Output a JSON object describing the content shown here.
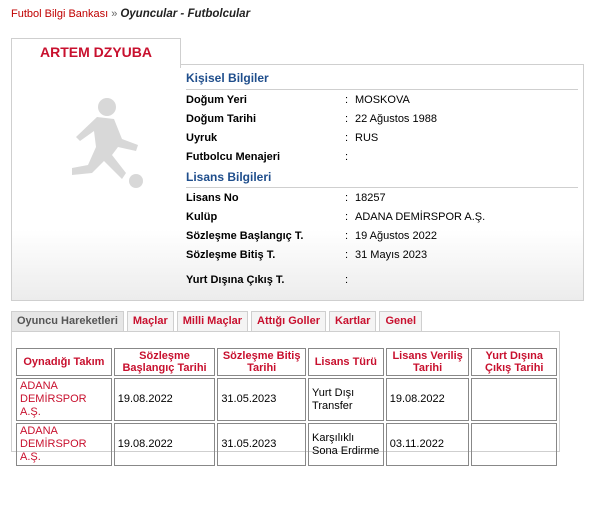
{
  "breadcrumb": {
    "root": "Futbol Bilgi Bankası",
    "separator": "»",
    "current": "Oyuncular - Futbolcular"
  },
  "player": {
    "name": "ARTEM DZYUBA"
  },
  "personal": {
    "title": "Kişisel Bilgiler",
    "rows": [
      {
        "label": "Doğum Yeri",
        "value": "MOSKOVA"
      },
      {
        "label": "Doğum Tarihi",
        "value": "22 Ağustos 1988"
      },
      {
        "label": "Uyruk",
        "value": "RUS"
      },
      {
        "label": "Futbolcu Menajeri",
        "value": ""
      }
    ]
  },
  "license": {
    "title": "Lisans Bilgileri",
    "rows": [
      {
        "label": "Lisans No",
        "value": "18257"
      },
      {
        "label": "Kulüp",
        "value": "ADANA DEMİRSPOR A.Ş."
      },
      {
        "label": "Sözleşme Başlangıç T.",
        "value": "19 Ağustos 2022"
      },
      {
        "label": "Sözleşme Bitiş T.",
        "value": "31 Mayıs 2023"
      },
      {
        "label": "Yurt Dışına Çıkış T.",
        "value": ""
      }
    ]
  },
  "tabs": [
    {
      "label": "Oyuncu Hareketleri",
      "active": true
    },
    {
      "label": "Maçlar"
    },
    {
      "label": "Milli Maçlar"
    },
    {
      "label": "Attığı Goller"
    },
    {
      "label": "Kartlar"
    },
    {
      "label": "Genel"
    }
  ],
  "movements": {
    "headers": [
      "Oynadığı Takım",
      "Sözleşme Başlangıç Tarihi",
      "Sözleşme Bitiş Tarihi",
      "Lisans Türü",
      "Lisans Veriliş Tarihi",
      "Yurt Dışına Çıkış Tarihi"
    ],
    "rows": [
      {
        "team": "ADANA DEMİRSPOR A.Ş.",
        "start": "19.08.2022",
        "end": "31.05.2023",
        "type": "Yurt Dışı Transfer",
        "issued": "19.08.2022",
        "abroad": ""
      },
      {
        "team": "ADANA DEMİRSPOR A.Ş.",
        "start": "19.08.2022",
        "end": "31.05.2023",
        "type": "Karşılıklı Sona Erdirme",
        "issued": "03.11.2022",
        "abroad": ""
      }
    ]
  },
  "colors": {
    "accent": "#c8102e",
    "section": "#1f4e8c"
  }
}
